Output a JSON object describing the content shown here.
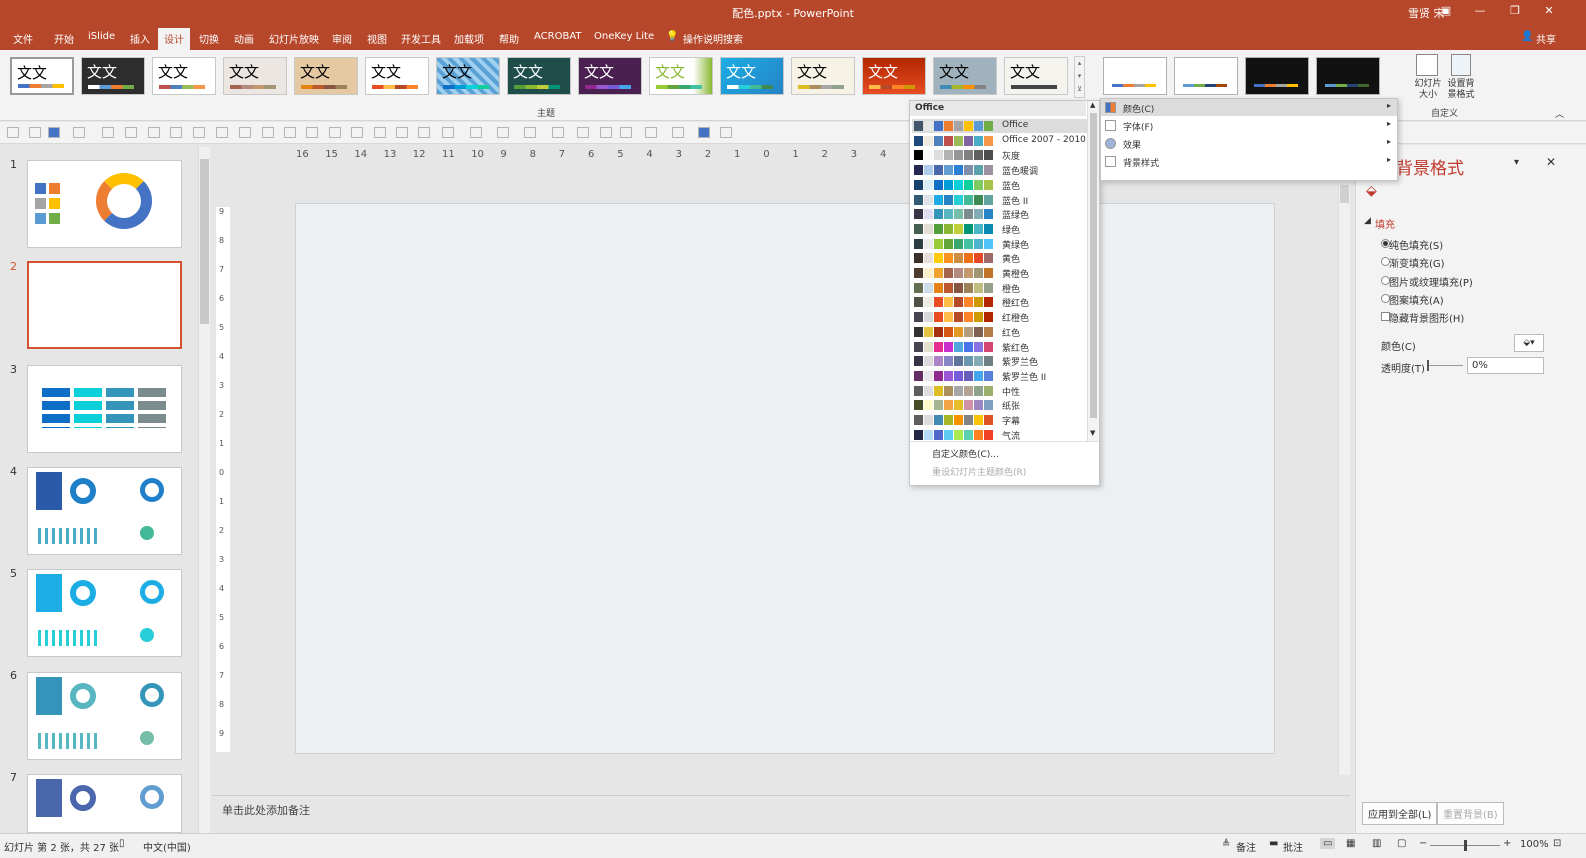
{
  "window": {
    "title": "配色.pptx - PowerPoint",
    "user": "雪贤 宋"
  },
  "tabs": [
    "文件",
    "开始",
    "iSlide",
    "插入",
    "设计",
    "切换",
    "动画",
    "幻灯片放映",
    "审阅",
    "视图",
    "开发工具",
    "加载项",
    "帮助",
    "ACROBAT",
    "OneKey Lite",
    "操作说明搜索"
  ],
  "share_label": "共享",
  "ribbon": {
    "group_theme": "主题",
    "group_custom": "自定义",
    "slide_size": "幻灯片大小",
    "bg_format": "设置背景格式",
    "theme_text": "文文"
  },
  "colors_dropdown": {
    "header": "Office",
    "schemes": [
      {
        "name": "Office",
        "colors": [
          "#44546a",
          "#e7e6e6",
          "#4472c4",
          "#ed7d31",
          "#a5a5a5",
          "#ffc000",
          "#5b9bd5",
          "#70ad47"
        ]
      },
      {
        "name": "Office 2007 - 2010",
        "colors": [
          "#1f497d",
          "#eeece1",
          "#4f81bd",
          "#c0504d",
          "#9bbb59",
          "#8064a2",
          "#4bacc6",
          "#f79646"
        ]
      },
      {
        "name": "灰度",
        "colors": [
          "#000000",
          "#f8f8f8",
          "#dddddd",
          "#b2b2b2",
          "#969696",
          "#808080",
          "#5f5f5f",
          "#4d4d4d"
        ]
      },
      {
        "name": "蓝色暖调",
        "colors": [
          "#242852",
          "#acccea",
          "#4a66ac",
          "#629dd1",
          "#297fd5",
          "#7f8fa9",
          "#5aa2ae",
          "#9d90a0"
        ]
      },
      {
        "name": "蓝色",
        "colors": [
          "#17406d",
          "#dbeff9",
          "#0f6fc6",
          "#009dd9",
          "#0bd0d9",
          "#10cf9b",
          "#7cca62",
          "#a5c249"
        ]
      },
      {
        "name": "蓝色 II",
        "colors": [
          "#335b74",
          "#dfe3e5",
          "#1cade4",
          "#2683c6",
          "#27ced7",
          "#42ba97",
          "#3e8853",
          "#62a39f"
        ]
      },
      {
        "name": "蓝绿色",
        "colors": [
          "#373545",
          "#dedef0",
          "#3494ba",
          "#58b6c0",
          "#75bda7",
          "#7a8c8e",
          "#84acb6",
          "#2683c6"
        ]
      },
      {
        "name": "绿色",
        "colors": [
          "#455f51",
          "#e3ded1",
          "#549e39",
          "#8ab833",
          "#c0cf3a",
          "#029676",
          "#4ab5c4",
          "#0989b1"
        ]
      },
      {
        "name": "黄绿色",
        "colors": [
          "#2c3c43",
          "#ebebeb",
          "#99cb38",
          "#63a537",
          "#37a76f",
          "#44c1a3",
          "#4eb3cf",
          "#51c3f9"
        ]
      },
      {
        "name": "黄色",
        "colors": [
          "#39302a",
          "#e5dedb",
          "#ffca08",
          "#f8931d",
          "#ce8d3e",
          "#ec7016",
          "#e64823",
          "#9c6a6a"
        ]
      },
      {
        "name": "黄橙色",
        "colors": [
          "#4e3b30",
          "#fbeec9",
          "#f0a22e",
          "#a5644e",
          "#b58b80",
          "#c3986d",
          "#a19574",
          "#c17529"
        ]
      },
      {
        "name": "橙色",
        "colors": [
          "#637052",
          "#ccddea",
          "#e48312",
          "#bd582c",
          "#865640",
          "#9b8357",
          "#c2bc80",
          "#94a088"
        ]
      },
      {
        "name": "橙红色",
        "colors": [
          "#505046",
          "#eeece1",
          "#e84c22",
          "#ffbd47",
          "#b64926",
          "#ff8427",
          "#cc9900",
          "#b22600"
        ]
      },
      {
        "name": "红橙色",
        "colors": [
          "#454551",
          "#d8d9dc",
          "#e84c22",
          "#ffbd47",
          "#b64926",
          "#ff8427",
          "#cc9900",
          "#b22600"
        ]
      },
      {
        "name": "红色",
        "colors": [
          "#323232",
          "#e5c243",
          "#a5300f",
          "#d55816",
          "#e19825",
          "#b19c7d",
          "#7f5f52",
          "#b27d49"
        ]
      },
      {
        "name": "紫红色",
        "colors": [
          "#454551",
          "#e2dfcc",
          "#e32d91",
          "#c830cc",
          "#4ea6dc",
          "#4775e7",
          "#8971e1",
          "#d54773"
        ]
      },
      {
        "name": "紫罗兰色",
        "colors": [
          "#373545",
          "#dcd8dc",
          "#ad84c6",
          "#8784c7",
          "#5d739a",
          "#6997af",
          "#84acb6",
          "#6f8183"
        ]
      },
      {
        "name": "紫罗兰色 II",
        "colors": [
          "#632e62",
          "#eae5eb",
          "#92278f",
          "#9b57d3",
          "#755dd9",
          "#665eb8",
          "#45a5ed",
          "#5982db"
        ]
      },
      {
        "name": "中性",
        "colors": [
          "#5e5e5e",
          "#ddddde",
          "#dcbd23",
          "#ac8f5e",
          "#a6a6a6",
          "#b3a393",
          "#8fa38a",
          "#9caf6c"
        ]
      },
      {
        "name": "纸张",
        "colors": [
          "#444d26",
          "#fefac9",
          "#a5b592",
          "#f3a447",
          "#e7bc29",
          "#d092a7",
          "#9c85c0",
          "#809ec2"
        ]
      },
      {
        "name": "字幕",
        "colors": [
          "#5e5e5e",
          "#dddddd",
          "#418ab3",
          "#a6b727",
          "#f69200",
          "#838383",
          "#fec306",
          "#df5327"
        ]
      },
      {
        "name": "气流",
        "colors": [
          "#212745",
          "#b4dcfa",
          "#4e67c8",
          "#5eccf3",
          "#a7ea52",
          "#5dceaf",
          "#ff8021",
          "#f14124"
        ]
      }
    ],
    "custom_label": "自定义颜色(C)...",
    "reset_label": "重设幻灯片主题颜色(R)"
  },
  "variant_menu": [
    {
      "label": "颜色(C)",
      "icon": "color-icon"
    },
    {
      "label": "字体(F)",
      "icon": "font-icon"
    },
    {
      "label": "效果",
      "icon": "effects-icon"
    },
    {
      "label": "背景样式",
      "icon": "background-style-icon"
    }
  ],
  "format_pane": {
    "title": "背景格式",
    "section": "填充",
    "options": [
      "纯色填充(S)",
      "渐变填充(G)",
      "图片或纹理填充(P)",
      "图案填充(A)"
    ],
    "checkbox": "隐藏背景图形(H)",
    "color_label": "颜色(C)",
    "transparency_label": "透明度(T)",
    "transparency_value": "0%",
    "apply_all": "应用到全部(L)",
    "reset_bg": "重置背景(B)"
  },
  "slides": [
    "1",
    "2",
    "3",
    "4",
    "5",
    "6",
    "7"
  ],
  "notes_placeholder": "单击此处添加备注",
  "status": {
    "slide_info": "幻灯片 第 2 张，共 27 张",
    "language": "中文(中国)",
    "notes": "备注",
    "comments": "批注",
    "zoom": "100%"
  },
  "ruler_h": [
    "16",
    "15",
    "14",
    "13",
    "12",
    "11",
    "10",
    "9",
    "8",
    "7",
    "6",
    "5",
    "4",
    "3",
    "2",
    "1",
    "0",
    "1",
    "2",
    "3",
    "4"
  ],
  "ruler_v": [
    "9",
    "8",
    "7",
    "6",
    "5",
    "4",
    "3",
    "2",
    "1",
    "0",
    "1",
    "2",
    "3",
    "4",
    "5",
    "6",
    "7",
    "8",
    "9"
  ]
}
